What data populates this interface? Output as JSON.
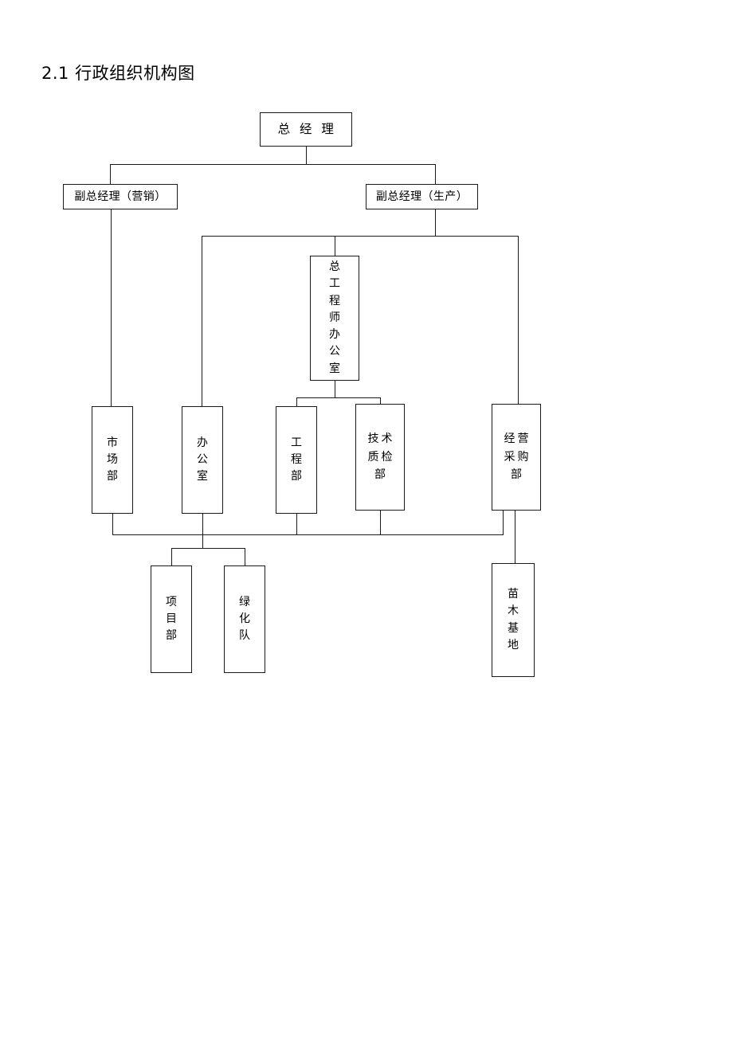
{
  "document": {
    "heading": "2.1 行政组织机构图"
  },
  "chart_data": {
    "type": "diagram",
    "title": "2.1 行政组织机构图",
    "diagram_kind": "organizational-chart",
    "orientation": "top-down",
    "nodes": [
      {
        "id": "gm",
        "label": "总  经  理",
        "text_layout": "horizontal-spaced",
        "level": 1
      },
      {
        "id": "vp-sales",
        "label": "副总经理（营销）",
        "text_layout": "horizontal",
        "level": 2
      },
      {
        "id": "vp-prod",
        "label": "副总经理（生产）",
        "text_layout": "horizontal",
        "level": 2
      },
      {
        "id": "chief-eng",
        "label": "总\n工\n程\n师\n办\n公\n室",
        "text_layout": "vertical",
        "level": 3
      },
      {
        "id": "market",
        "label": "市\n场\n部",
        "text_layout": "vertical",
        "level": 4
      },
      {
        "id": "office",
        "label": "办\n公\n室",
        "text_layout": "vertical",
        "level": 4
      },
      {
        "id": "engineer",
        "label": "工\n程\n部",
        "text_layout": "vertical",
        "level": 4
      },
      {
        "id": "tech-qc",
        "label": "技术\n质检\n部",
        "text_layout": "vertical-two-column",
        "level": 4
      },
      {
        "id": "purchase",
        "label": "经营\n采购\n部",
        "text_layout": "vertical-two-column",
        "level": 4
      },
      {
        "id": "project",
        "label": "项\n目\n部",
        "text_layout": "vertical",
        "level": 5
      },
      {
        "id": "greening",
        "label": "绿\n化\n队",
        "text_layout": "vertical",
        "level": 5
      },
      {
        "id": "nursery",
        "label": "苗\n木\n基\n地",
        "text_layout": "vertical",
        "level": 5
      }
    ],
    "edges": [
      {
        "from": "gm",
        "to": "vp-sales"
      },
      {
        "from": "gm",
        "to": "vp-prod"
      },
      {
        "from": "vp-sales",
        "to": "market"
      },
      {
        "from": "vp-prod",
        "to": "office"
      },
      {
        "from": "vp-prod",
        "to": "chief-eng"
      },
      {
        "from": "vp-prod",
        "to": "purchase"
      },
      {
        "from": "chief-eng",
        "to": "engineer"
      },
      {
        "from": "chief-eng",
        "to": "tech-qc"
      },
      {
        "from": "market",
        "to": "project"
      },
      {
        "from": "office",
        "to": "project"
      },
      {
        "from": "engineer",
        "to": "project"
      },
      {
        "from": "tech-qc",
        "to": "project"
      },
      {
        "from": "purchase",
        "to": "project"
      },
      {
        "from": "market",
        "to": "greening"
      },
      {
        "from": "office",
        "to": "greening"
      },
      {
        "from": "engineer",
        "to": "greening"
      },
      {
        "from": "tech-qc",
        "to": "greening"
      },
      {
        "from": "purchase",
        "to": "greening"
      },
      {
        "from": "purchase",
        "to": "nursery"
      }
    ],
    "colors": {
      "line": "#1a1a1a",
      "box_border": "#1a1a1a",
      "box_fill": "#ffffff",
      "text": "#000000",
      "background": "#ffffff"
    }
  }
}
